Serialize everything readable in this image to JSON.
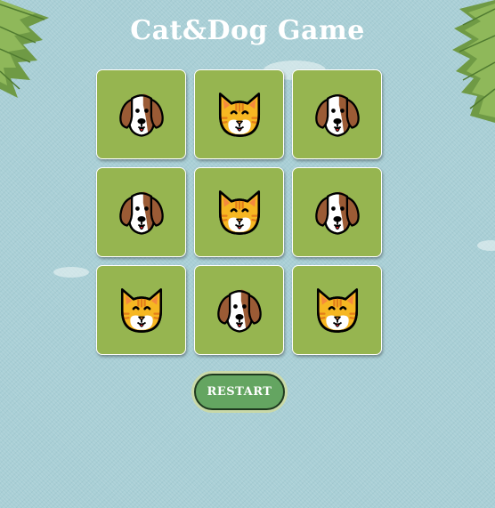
{
  "title": "Cat&Dog Game",
  "restart_label": "RESTART",
  "board": [
    [
      "dog",
      "cat",
      "dog"
    ],
    [
      "dog",
      "cat",
      "dog"
    ],
    [
      "cat",
      "dog",
      "cat"
    ]
  ],
  "icons": {
    "dog": "dog-face-icon",
    "cat": "cat-face-icon"
  },
  "colors": {
    "background": "#a9cfd6",
    "cell": "#96b550",
    "button": "#64a561",
    "title": "#ffffff"
  }
}
